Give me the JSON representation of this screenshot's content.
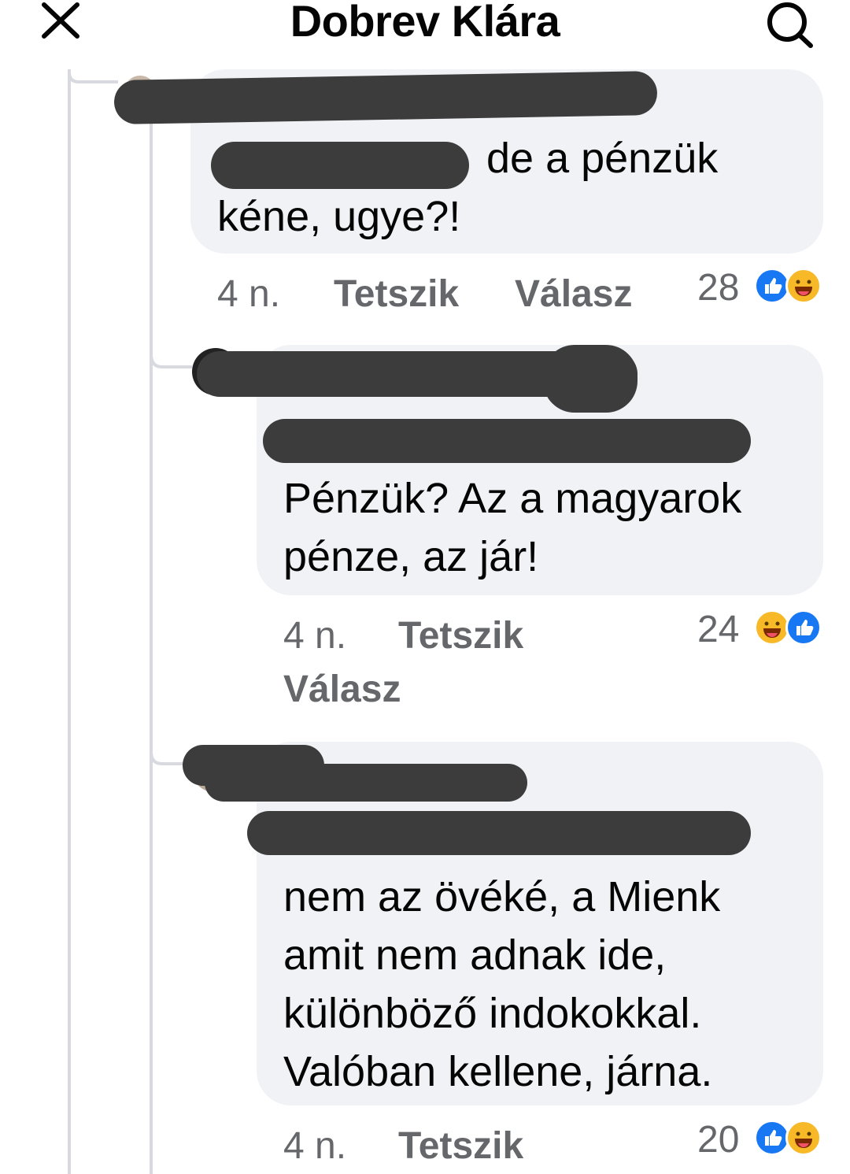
{
  "header": {
    "title": "Dobrev Klára",
    "close_icon": "close-icon",
    "search_icon": "search-icon"
  },
  "comments": [
    {
      "text": "de a pénzük\nkéne, ugye?!",
      "line1": "de a pénzük",
      "line2": "kéne, ugye?!",
      "time": "4 n.",
      "like_label": "Tetszik",
      "reply_label": "Válasz",
      "reaction_count": "28",
      "reactions": [
        "like-icon",
        "haha-icon"
      ]
    },
    {
      "line1": "Pénzük? Az a magyarok",
      "line2": "pénze, az jár!",
      "time": "4 n.",
      "like_label": "Tetszik",
      "reply_label": "Válasz",
      "reaction_count": "24",
      "reactions": [
        "haha-icon",
        "like-icon"
      ]
    },
    {
      "line1": "nem az övéké, a Mienk",
      "line2": "amit nem adnak ide,",
      "line3": "különböző indokokkal.",
      "line4": "Valóban kellene, járna.",
      "time": "4 n.",
      "like_label": "Tetszik",
      "reaction_count": "20",
      "reactions": [
        "like-icon",
        "haha-icon"
      ]
    }
  ],
  "colors": {
    "bubble": "#f0f2f5",
    "meta_text": "#65676b",
    "like_blue": "#1877f2",
    "haha_yellow": "#f7b928",
    "redaction": "#3c3c3c"
  }
}
